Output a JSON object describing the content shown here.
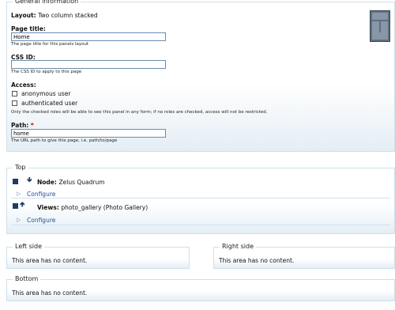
{
  "general": {
    "legend": "General information",
    "layout_label": "Layout:",
    "layout_value": "Two column stacked",
    "page_title_label": "Page title:",
    "page_title_value": "Home",
    "page_title_desc": "The page title for this panels layout",
    "css_id_label": "CSS ID:",
    "css_id_value": "",
    "css_id_desc": "The CSS ID to apply to this page",
    "access_label": "Access:",
    "roles": [
      "anonymous user",
      "authenticated user"
    ],
    "access_desc": "Only the checked roles will be able to see this panel in any form; if no roles are checked, access will not be restricted.",
    "path_label": "Path:",
    "path_required": "*",
    "path_value": "home",
    "path_desc": "The URL path to give this page, i.e. path/to/page"
  },
  "top": {
    "legend": "Top",
    "panes": [
      {
        "type": "Node:",
        "title": "Zelus Quadrum",
        "configure": "Configure"
      },
      {
        "type": "Views:",
        "title": "photo_gallery (Photo Gallery)",
        "configure": "Configure"
      }
    ]
  },
  "left": {
    "legend": "Left side",
    "empty": "This area has no content."
  },
  "right": {
    "legend": "Right side",
    "empty": "This area has no content."
  },
  "bottom": {
    "legend": "Bottom",
    "empty": "This area has no content."
  },
  "icons": {
    "layout": "two-column-stacked-layout-icon",
    "pane": "pane-icon",
    "down": "arrow-down-icon",
    "up": "arrow-up-icon",
    "configure": "triangle-right-icon"
  }
}
